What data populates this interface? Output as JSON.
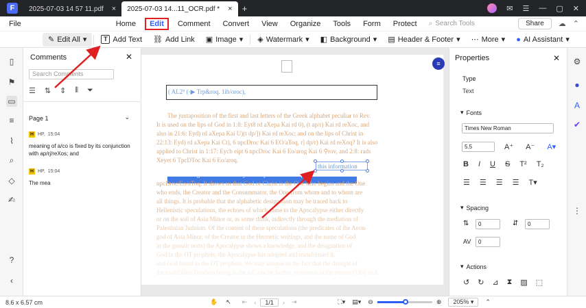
{
  "titlebar": {
    "tabs": [
      {
        "label": "2025-07-03 14 57 11.pdf",
        "close": "×"
      },
      {
        "label": "2025-07-03 14...11_OCR.pdf *",
        "close": "×"
      }
    ],
    "new_tab": "+"
  },
  "menu": {
    "file": "File",
    "items": [
      "Home",
      "Edit",
      "Comment",
      "Convert",
      "View",
      "Organize",
      "Tools",
      "Form",
      "Protect"
    ],
    "search_placeholder": "Search Tools",
    "share": "Share"
  },
  "toolbar": {
    "edit_all": "Edit All",
    "add_text": "Add Text",
    "add_link": "Add Link",
    "image": "Image",
    "watermark": "Watermark",
    "background": "Background",
    "header_footer": "Header & Footer",
    "more": "More",
    "ai_assistant": "AI Assistant"
  },
  "comments": {
    "title": "Comments",
    "search_placeholder": "Search Comments",
    "page_label": "Page 1",
    "items": [
      {
        "author": "HP,",
        "time": "15:04",
        "text": "meaning of a/co is fixed by its conjunction with ap/rj/reXos; and"
      },
      {
        "author": "HP,",
        "time": "15:04",
        "text": "The mea"
      }
    ]
  },
  "document": {
    "header_field": "( AL2⁵ (·▶ Trp&roq. 1ib/oroc),",
    "lines": [
      "The juxtaposition of the first and last letters of the Greek alphabet peculiar to Rev.",
      "It is used on the lips of God in 1:8: Eyt8 rd aXepa Kai rd 0), (t ap/r) Kai rd reXoc, and",
      "also in 21:6: Eyd) rd aXepa Kai U)(t dp/]) Kai rd reXoc; and on the lips of Christ in",
      "22:13: Eyd) rd aXepa Kai Ct), 6 npcDroc Kai 6 EO/aToq, r] dp/r) Kai rd reXoq? It is also",
      "applied to Christ in 1:17: Eycb eipt 6 npcDroc Kai 6 Eo/arog Kai 6 ⚲rov, and 2:8: rads",
      "Xeyet 6 TpcDToc Kai 6 Eo/aroq.",
      "",
      "The meaning of a/co is fixed by its conjunction with ap/rj/reXoc and",
      "npcDroc/Eo/aToq. It shows us that God or Christ is the One who begins and the One",
      "who ends, the Creator and the Consummator, the One from whom and to whom are",
      "all things. It is probable that the alphabetic designation may be traced back to",
      "Hellenistic speculations, the echoes of which came to the Apocalypse either directly",
      "or on the soil of Asia Minor or, as some think, indirectly through the mediation of",
      "Palestinian Judaism. Of the content of these speculations (the predicates of the Aeon-",
      "god of Asia Minor, of the Creator in the Hermetic writings, and the name of God",
      "in the gnostic texts) the Apocalypse shows a knowledge, and the designation of",
      "God in the OT prophets, the Apocalypse has adopted and transformed it.",
      "and God found in the OT prophets. We may assume to the fact that the thought of",
      "the truthFilled Timeless being in the a/C can be further expressed in the phrase O Rrj rrtA"
    ],
    "textbox": "this information"
  },
  "properties": {
    "title": "Properties",
    "type_label": "Type",
    "type_value": "Text",
    "fonts_label": "Fonts",
    "font_family": "Times New Roman",
    "font_size": "5.5",
    "spacing_label": "Spacing",
    "line_spacing": "0",
    "char_spacing": "0",
    "av_spacing": "0",
    "actions_label": "Actions"
  },
  "status": {
    "dimensions": "8.6 x 6.57 cm",
    "page": "1/1",
    "zoom": "205%",
    "zoom_level": 0.52
  },
  "colors": {
    "accent": "#2c5ff7",
    "highlight_box": "#e02020",
    "arrow": "#e02020",
    "doc_text": "#d8a77a"
  }
}
